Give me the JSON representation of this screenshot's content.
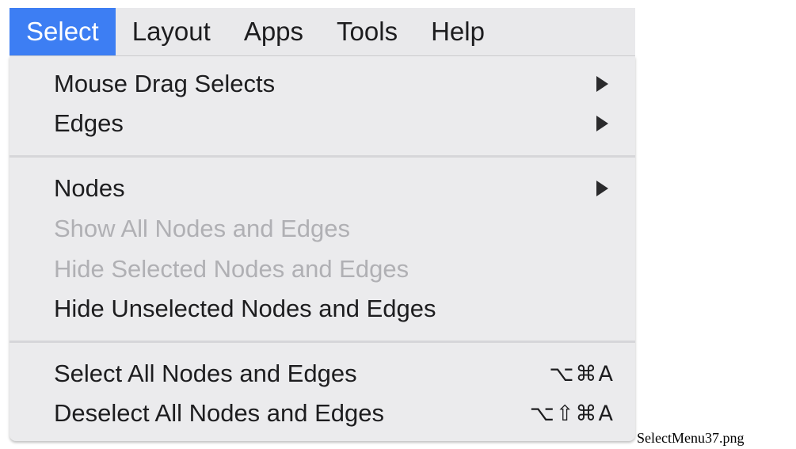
{
  "menubar": {
    "items": [
      {
        "label": "Select",
        "active": true
      },
      {
        "label": "Layout",
        "active": false
      },
      {
        "label": "Apps",
        "active": false
      },
      {
        "label": "Tools",
        "active": false
      },
      {
        "label": "Help",
        "active": false
      }
    ]
  },
  "menu": {
    "group1": [
      {
        "label": "Mouse Drag Selects",
        "submenu": true,
        "enabled": true
      },
      {
        "label": "Edges",
        "submenu": true,
        "enabled": true
      }
    ],
    "group2": [
      {
        "label": "Nodes",
        "submenu": true,
        "enabled": true
      },
      {
        "label": "Show All Nodes and Edges",
        "submenu": false,
        "enabled": false
      },
      {
        "label": "Hide Selected Nodes and Edges",
        "submenu": false,
        "enabled": false
      },
      {
        "label": "Hide Unselected Nodes and Edges",
        "submenu": false,
        "enabled": true
      }
    ],
    "group3": [
      {
        "label": "Select All Nodes and Edges",
        "shortcut": "⌥⌘A",
        "enabled": true
      },
      {
        "label": "Deselect All Nodes and Edges",
        "shortcut": "⌥⇧⌘A",
        "enabled": true
      }
    ]
  },
  "caption": "SelectMenu37.png",
  "colors": {
    "accent": "#3d7ef3",
    "menu_background": "#ebebed",
    "disabled_text": "#b0b0b4"
  }
}
